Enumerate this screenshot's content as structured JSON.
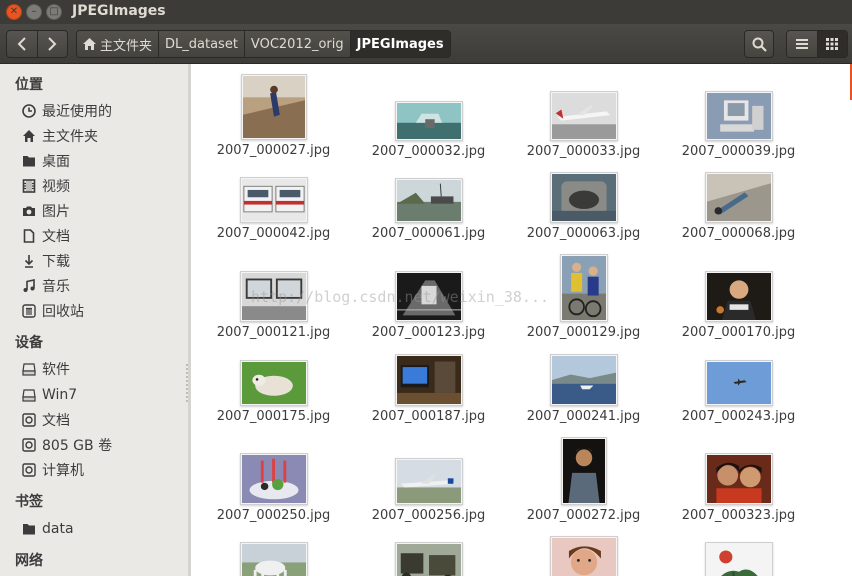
{
  "window": {
    "title": "JPEGImages"
  },
  "toolbar": {
    "back_icon": "chevron-left-icon",
    "forward_icon": "chevron-right-icon",
    "breadcrumbs": [
      {
        "label": "主文件夹",
        "icon": "home-icon"
      },
      {
        "label": "DL_dataset"
      },
      {
        "label": "VOC2012_orig"
      },
      {
        "label": "JPEGImages"
      }
    ],
    "search_icon": "search-icon",
    "list_view_icon": "list-view-icon",
    "grid_view_icon": "grid-view-icon"
  },
  "sidebar": {
    "sections": [
      {
        "title": "位置",
        "items": [
          {
            "label": "最近使用的",
            "icon": "clock-icon"
          },
          {
            "label": "主文件夹",
            "icon": "home-icon"
          },
          {
            "label": "桌面",
            "icon": "folder-icon"
          },
          {
            "label": "视频",
            "icon": "film-icon"
          },
          {
            "label": "图片",
            "icon": "camera-icon"
          },
          {
            "label": "文档",
            "icon": "document-icon"
          },
          {
            "label": "下载",
            "icon": "download-icon"
          },
          {
            "label": "音乐",
            "icon": "music-icon"
          },
          {
            "label": "回收站",
            "icon": "trash-icon"
          }
        ]
      },
      {
        "title": "设备",
        "items": [
          {
            "label": "软件",
            "icon": "drive-icon"
          },
          {
            "label": "Win7",
            "icon": "drive-icon"
          },
          {
            "label": "文档",
            "icon": "disk-icon"
          },
          {
            "label": "805 GB 卷",
            "icon": "disk-icon"
          },
          {
            "label": "计算机",
            "icon": "disk-icon"
          }
        ]
      },
      {
        "title": "书签",
        "items": [
          {
            "label": "data",
            "icon": "folder-icon"
          }
        ]
      },
      {
        "title": "网络",
        "items": []
      }
    ]
  },
  "files": [
    {
      "name": "2007_000027.jpg"
    },
    {
      "name": "2007_000032.jpg"
    },
    {
      "name": "2007_000033.jpg"
    },
    {
      "name": "2007_000039.jpg"
    },
    {
      "name": "2007_000042.jpg"
    },
    {
      "name": "2007_000061.jpg"
    },
    {
      "name": "2007_000063.jpg"
    },
    {
      "name": "2007_000068.jpg"
    },
    {
      "name": "2007_000121.jpg"
    },
    {
      "name": "2007_000123.jpg"
    },
    {
      "name": "2007_000129.jpg"
    },
    {
      "name": "2007_000170.jpg"
    },
    {
      "name": "2007_000175.jpg"
    },
    {
      "name": "2007_000187.jpg"
    },
    {
      "name": "2007_000241.jpg"
    },
    {
      "name": "2007_000243.jpg"
    },
    {
      "name": "2007_000250.jpg"
    },
    {
      "name": "2007_000256.jpg"
    },
    {
      "name": "2007_000272.jpg"
    },
    {
      "name": "2007_000323.jpg"
    },
    {
      "name": ""
    },
    {
      "name": ""
    },
    {
      "name": ""
    },
    {
      "name": ""
    }
  ],
  "watermark": "http://blog.csdn.net/weixin_38..."
}
